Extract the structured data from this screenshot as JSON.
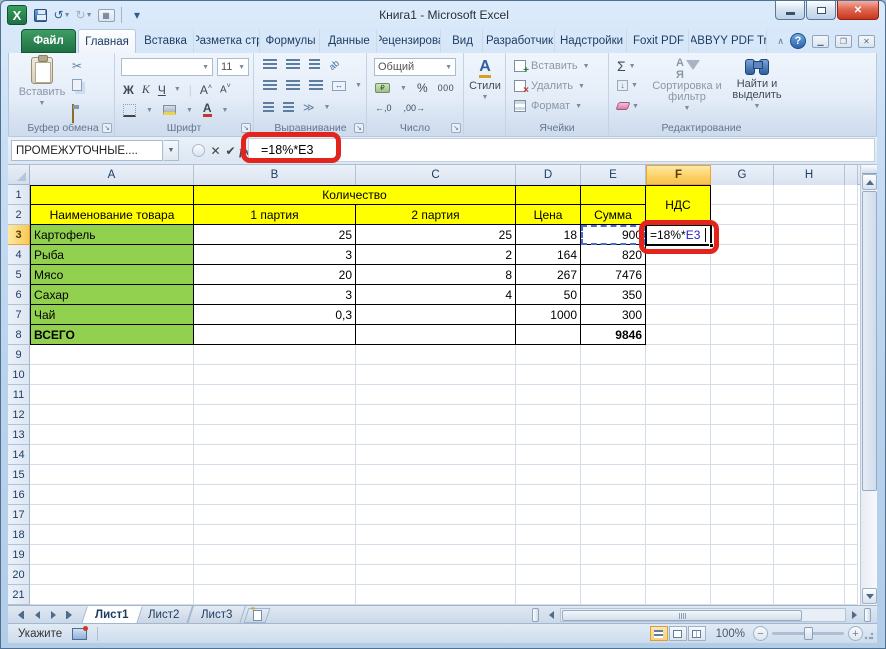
{
  "window": {
    "title": "Книга1  -  Microsoft Excel"
  },
  "ribbon_tabs": [
    {
      "label": "Файл",
      "kind": "file"
    },
    {
      "label": "Главная",
      "active": true
    },
    {
      "label": "Вставка"
    },
    {
      "label": "Разметка стр"
    },
    {
      "label": "Формулы"
    },
    {
      "label": "Данные"
    },
    {
      "label": "Рецензирова"
    },
    {
      "label": "Вид"
    },
    {
      "label": "Разработчик"
    },
    {
      "label": "Надстройки"
    },
    {
      "label": "Foxit PDF"
    },
    {
      "label": "ABBYY PDF Tr"
    }
  ],
  "ribbon": {
    "clipboard": {
      "label": "Буфер обмена",
      "paste": "Вставить"
    },
    "font": {
      "label": "Шрифт",
      "size": "11",
      "bold": "Ж",
      "italic": "К",
      "underline": "Ч",
      "grow": "А",
      "shrink": "А"
    },
    "alignment": {
      "label": "Выравнивание"
    },
    "number": {
      "label": "Число",
      "format": "Общий",
      "percent": "%",
      "thousands": "000"
    },
    "styles": {
      "label": "Стили"
    },
    "cells": {
      "label": "Ячейки",
      "insert": "Вставить",
      "delete": "Удалить",
      "format": "Формат"
    },
    "editing": {
      "label": "Редактирование",
      "autosum": "Σ",
      "sort": "Сортировка и фильтр",
      "find": "Найти и выделить"
    }
  },
  "formula_bar": {
    "name_box": "ПРОМЕЖУТОЧНЫЕ....",
    "fx": "fx",
    "formula": "=18%*E3"
  },
  "grid": {
    "col_headers": [
      "A",
      "B",
      "C",
      "D",
      "E",
      "F",
      "G",
      "H"
    ],
    "selected_col": "F",
    "selected_row": 3,
    "rows": 21,
    "cells": [
      {
        "r": 1,
        "c": "A",
        "bg": "yellow",
        "b": 1
      },
      {
        "r": 1,
        "c": "B",
        "span": 2,
        "t": "Количество",
        "bg": "yellow",
        "al": "center",
        "b": 1
      },
      {
        "r": 1,
        "c": "D",
        "bg": "yellow",
        "b": 1
      },
      {
        "r": 1,
        "c": "E",
        "bg": "yellow",
        "b": 1
      },
      {
        "r": 1,
        "c": "F",
        "rspan": 2,
        "t": "НДС",
        "bg": "yellow",
        "al": "center",
        "b": 1
      },
      {
        "r": 2,
        "c": "A",
        "t": "Наименование товара",
        "bg": "yellow",
        "al": "center",
        "b": 1
      },
      {
        "r": 2,
        "c": "B",
        "t": "1 партия",
        "bg": "yellow",
        "al": "center",
        "b": 1
      },
      {
        "r": 2,
        "c": "C",
        "t": "2 партия",
        "bg": "yellow",
        "al": "center",
        "b": 1
      },
      {
        "r": 2,
        "c": "D",
        "t": "Цена",
        "bg": "yellow",
        "al": "center",
        "b": 1
      },
      {
        "r": 2,
        "c": "E",
        "t": "Сумма",
        "bg": "yellow",
        "al": "center",
        "b": 1
      },
      {
        "r": 3,
        "c": "A",
        "t": "Картофель",
        "bg": "green",
        "b": 1
      },
      {
        "r": 3,
        "c": "B",
        "t": "25",
        "al": "right",
        "b": 1
      },
      {
        "r": 3,
        "c": "C",
        "t": "25",
        "al": "right",
        "b": 1
      },
      {
        "r": 3,
        "c": "D",
        "t": "18",
        "al": "right",
        "b": 1
      },
      {
        "r": 3,
        "c": "E",
        "t": "900",
        "al": "right",
        "b": 1,
        "ants": 1
      },
      {
        "r": 4,
        "c": "A",
        "t": "Рыба",
        "bg": "green",
        "b": 1
      },
      {
        "r": 4,
        "c": "B",
        "t": "3",
        "al": "right",
        "b": 1
      },
      {
        "r": 4,
        "c": "C",
        "t": "2",
        "al": "right",
        "b": 1
      },
      {
        "r": 4,
        "c": "D",
        "t": "164",
        "al": "right",
        "b": 1
      },
      {
        "r": 4,
        "c": "E",
        "t": "820",
        "al": "right",
        "b": 1
      },
      {
        "r": 5,
        "c": "A",
        "t": "Мясо",
        "bg": "green",
        "b": 1
      },
      {
        "r": 5,
        "c": "B",
        "t": "20",
        "al": "right",
        "b": 1
      },
      {
        "r": 5,
        "c": "C",
        "t": "8",
        "al": "right",
        "b": 1
      },
      {
        "r": 5,
        "c": "D",
        "t": "267",
        "al": "right",
        "b": 1
      },
      {
        "r": 5,
        "c": "E",
        "t": "7476",
        "al": "right",
        "b": 1
      },
      {
        "r": 6,
        "c": "A",
        "t": "Сахар",
        "bg": "green",
        "b": 1
      },
      {
        "r": 6,
        "c": "B",
        "t": "3",
        "al": "right",
        "b": 1
      },
      {
        "r": 6,
        "c": "C",
        "t": "4",
        "al": "right",
        "b": 1
      },
      {
        "r": 6,
        "c": "D",
        "t": "50",
        "al": "right",
        "b": 1
      },
      {
        "r": 6,
        "c": "E",
        "t": "350",
        "al": "right",
        "b": 1
      },
      {
        "r": 7,
        "c": "A",
        "t": "Чай",
        "bg": "green",
        "b": 1
      },
      {
        "r": 7,
        "c": "B",
        "t": "0,3",
        "al": "right",
        "b": 1
      },
      {
        "r": 7,
        "c": "C",
        "b": 1
      },
      {
        "r": 7,
        "c": "D",
        "t": "1000",
        "al": "right",
        "b": 1
      },
      {
        "r": 7,
        "c": "E",
        "t": "300",
        "al": "right",
        "b": 1
      },
      {
        "r": 8,
        "c": "A",
        "t": "ВСЕГО",
        "bg": "green",
        "bold": 1,
        "b": 1
      },
      {
        "r": 8,
        "c": "B",
        "b": 1
      },
      {
        "r": 8,
        "c": "C",
        "b": 1
      },
      {
        "r": 8,
        "c": "D",
        "b": 1
      },
      {
        "r": 8,
        "c": "E",
        "t": "9846",
        "al": "right",
        "bold": 1,
        "b": 1
      }
    ],
    "edit_cell": {
      "row": 3,
      "col": "F",
      "before": "=18%*",
      "ref": "E3",
      "ref_color": "#2222cc"
    }
  },
  "sheet_bar": {
    "tabs": [
      {
        "label": "Лист1",
        "active": true
      },
      {
        "label": "Лист2"
      },
      {
        "label": "Лист3"
      }
    ]
  },
  "status_bar": {
    "mode": "Укажите",
    "zoom": "100%"
  },
  "highlight_color": "#e2241d"
}
